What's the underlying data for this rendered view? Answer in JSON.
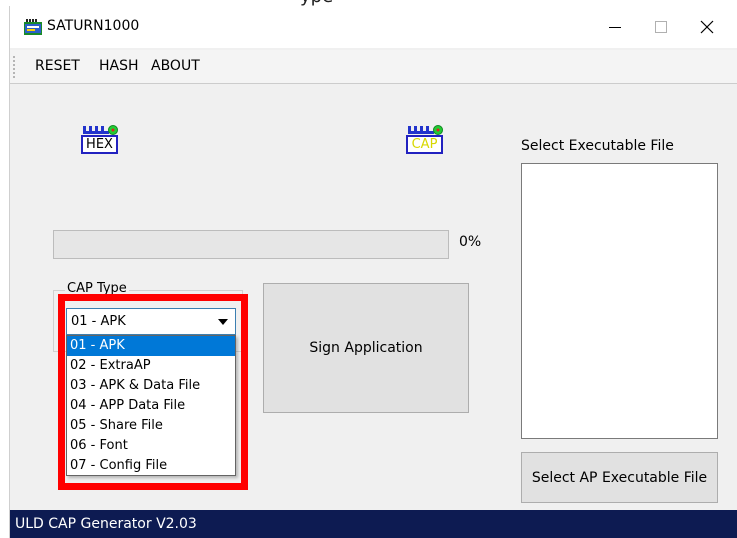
{
  "caption": "ype",
  "window": {
    "title": "SATURN1000",
    "icons": {
      "app": "app-icon",
      "minimize": "minimize-icon",
      "maximize": "maximize-icon",
      "close": "close-icon"
    }
  },
  "menu": {
    "reset": "RESET",
    "hash": "HASH",
    "about": "ABOUT"
  },
  "indicators": {
    "hex": {
      "label": "HEX",
      "icon": "hex-file-icon"
    },
    "cap": {
      "label": "CAP",
      "icon": "cap-file-icon",
      "label_color": "#d8d800"
    }
  },
  "executable": {
    "label": "Select Executable File",
    "button_label": "Select AP Executable File"
  },
  "progress": {
    "value": 0,
    "text": "0%"
  },
  "cap_type": {
    "label": "CAP Type",
    "selected": "01 - APK",
    "options": [
      "01 - APK",
      "02 - ExtraAP",
      "03 - APK & Data File",
      "04 - APP Data File",
      "05 - Share File",
      "06 - Font",
      "07 - Config File"
    ],
    "highlighted_index": 0
  },
  "sign_button": {
    "label": "Sign Application"
  },
  "status": {
    "text": "ULD CAP Generator V2.03"
  },
  "colors": {
    "highlight_border": "#ff0000",
    "selection": "#0078d7",
    "status_bar": "#0d1b52",
    "icon_border": "#2222c0"
  }
}
